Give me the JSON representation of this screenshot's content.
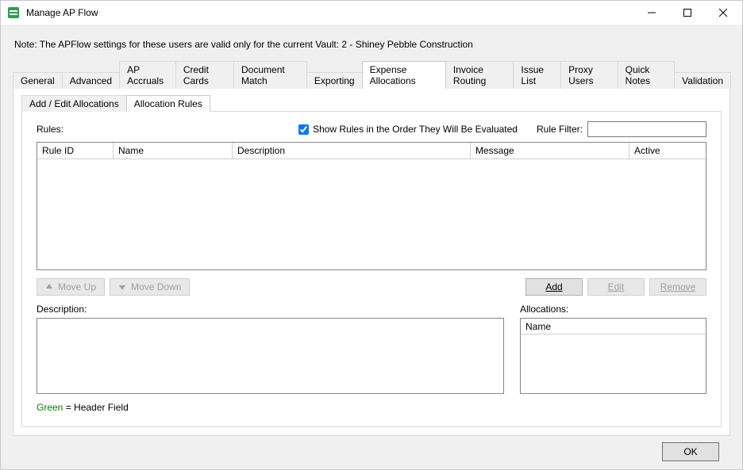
{
  "window": {
    "title": "Manage AP Flow"
  },
  "note": "Note:  The APFlow settings for these users are valid only for the current Vault: 2 - Shiney Pebble Construction",
  "tabs": {
    "outer": [
      "General",
      "Advanced",
      "AP Accruals",
      "Credit Cards",
      "Document Match",
      "Exporting",
      "Expense Allocations",
      "Invoice Routing",
      "Issue List",
      "Proxy Users",
      "Quick Notes",
      "Validation"
    ],
    "outer_active_index": 6,
    "inner": [
      "Add / Edit Allocations",
      "Allocation Rules"
    ],
    "inner_active_index": 1
  },
  "rules": {
    "label": "Rules:",
    "show_order_label": "Show Rules in the Order They Will Be Evaluated",
    "show_order_checked": true,
    "filter_label": "Rule Filter:",
    "filter_value": "",
    "columns": {
      "rule_id": "Rule ID",
      "name": "Name",
      "description": "Description",
      "message": "Message",
      "active": "Active"
    },
    "rows": []
  },
  "buttons": {
    "move_up": "Move Up",
    "move_down": "Move Down",
    "add": "Add",
    "edit": "Edit",
    "remove": "Remove",
    "ok": "OK"
  },
  "description": {
    "label": "Description:",
    "value": ""
  },
  "allocations": {
    "label": "Allocations:",
    "col_name": "Name",
    "rows": []
  },
  "legend": {
    "green": "Green",
    "rest": "  = Header Field"
  }
}
